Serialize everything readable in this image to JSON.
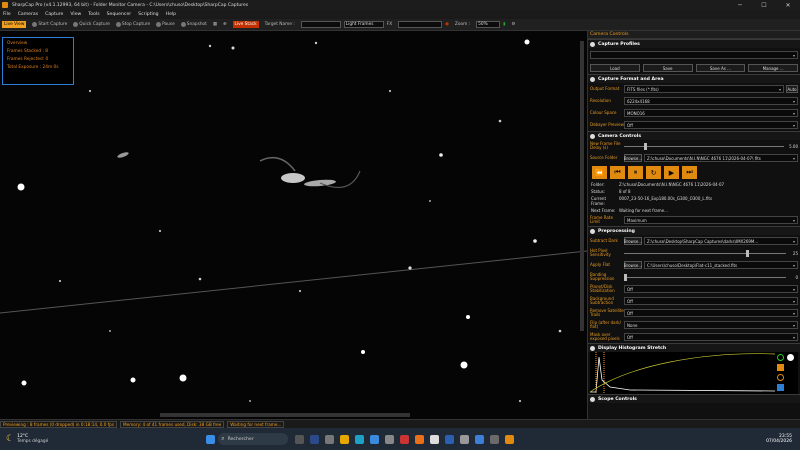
{
  "window": {
    "title": "SharpCap Pro (v4.1.12993, 64 bit) - Folder Monitor Camera - C:\\Users\\chuso\\Desktop\\SharpCap Captures",
    "min": "─",
    "max": "☐",
    "close": "✕"
  },
  "menu": [
    "File",
    "Cameras",
    "Capture",
    "View",
    "Tools",
    "Sequencer",
    "Scripting",
    "Help"
  ],
  "toolbar": {
    "live_view": "Live View",
    "start_capture": "Start Capture",
    "quick_capture": "Quick Capture",
    "stop_capture": "Stop Capture",
    "pause": "Pause",
    "snapshot": "Snapshot",
    "live_stack": "Live Stack",
    "target_name": "Target Name :",
    "target_value": "",
    "frame_type": "Light Frames",
    "fx": "FX",
    "fx_value": "",
    "zoom_label": "Zoom :",
    "zoom_value": "50%"
  },
  "overview": {
    "title": "Overview",
    "frames_stacked": "Frames Stacked : 8",
    "frames_rejected": "Frames Rejected: 0",
    "total_exposure": "Total Exposure :  24m 0s"
  },
  "panel": {
    "title": "Camera Controls",
    "capture_profiles": {
      "title": "Capture Profiles",
      "load": "Load",
      "save": "Save",
      "save_as": "Save As ...",
      "manage": "Manage ..."
    },
    "capture_format": {
      "title": "Capture Format and Area",
      "output_format_label": "Output Format",
      "output_format": "FITS files (*.fits)",
      "auto": "Auto",
      "resolution_label": "Resolution",
      "resolution": "6224x4168",
      "colour_space_label": "Colour Space",
      "colour_space": "MONO16",
      "debayer_label": "Debayer Preview",
      "debayer": "Off"
    },
    "camera_controls": {
      "title": "Camera Controls",
      "new_frame_label": "New Frame File Delay (s)",
      "new_frame_value": "5.00",
      "source_folder_label": "Source Folder",
      "browse": "Browse...",
      "source_folder": "Z:\\chuso\\Documents\\N.I.N\\NGC 4676 11\\2026-04-07\\ fits",
      "folder_k": "Folder:",
      "folder_v": "Z:\\chuso\\Documents\\N.I.N\\NGC 4676 11\\2026-04-07",
      "status_k": "Status:",
      "status_v": "8 of 8",
      "current_k": "Current Frame:",
      "current_v": "0007_23-50-16_Exp180.00s_G300_O300_L.fits",
      "next_k": "Next Frame:",
      "next_v": "Waiting for next frame...",
      "frame_rate_label": "Frame Rate Limit",
      "frame_rate": "Maximum"
    },
    "preprocessing": {
      "title": "Preprocessing",
      "subtract_dark_label": "Subtract Dark",
      "subtract_dark": "Z:\\chuso\\Desktop\\SharpCap Captures\\darks\\IMX269M...",
      "hot_pixel_label": "Hot Pixel Sensitivity",
      "hot_pixel_value": "25",
      "apply_flat_label": "Apply Flat",
      "apply_flat": "C:\\Users\\chuso\\Desktop\\Flat-c11_stacked.fits",
      "banding_label": "Banding Suppression",
      "banding_value": "0",
      "planet_disk_label": "Planet/Disk Stabilization",
      "planet_disk": "Off",
      "background_label": "Background Subtraction",
      "background": "Off",
      "satellite_label": "Remove Satellite Trails",
      "satellite": "Off",
      "flip_label": "Flip (after dark/ flat)",
      "flip": "None",
      "mask_label": "Mask over exposed pixels",
      "mask": "Off"
    },
    "histogram": {
      "title": "Display Histogram Stretch"
    },
    "scope": {
      "title": "Scope Controls"
    }
  },
  "status": {
    "preview": "Previewing : 8 frames (0 dropped) in 0:18:14, 0.0 fps",
    "memory": "Memory: 4 of 41 frames used, Disk: 38 GB free",
    "waiting": "Waiting for next frame..."
  },
  "taskbar": {
    "temp": "12°C",
    "weather": "Temps dégagé",
    "search": "Rechercher",
    "time": "23:55",
    "date": "07/04/2026"
  },
  "colors": {
    "accent": "#e89a20",
    "button": "#e08a10"
  }
}
